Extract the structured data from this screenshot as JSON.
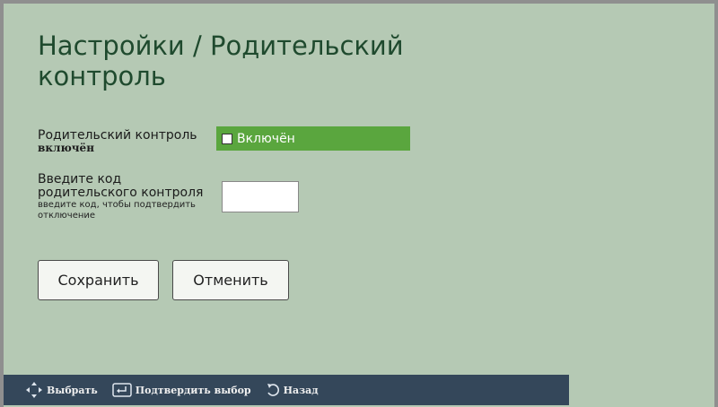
{
  "page": {
    "title": "Настройки / Родительский контроль"
  },
  "parental": {
    "status_label": "Родительский контроль",
    "status_value": "включён",
    "toggle_label": "Включён",
    "toggle_checked": false
  },
  "code": {
    "label": "Введите код родительского контроля",
    "hint": "введите код, чтобы подтвердить отключение",
    "value": ""
  },
  "buttons": {
    "save_label": "Сохранить",
    "cancel_label": "Отменить"
  },
  "footer": {
    "select_label": "Выбрать",
    "confirm_label": "Подтвердить выбор",
    "back_label": "Назад",
    "select_icon": "dpad-arrows-icon",
    "confirm_icon": "enter-key-icon",
    "back_icon": "back-arrow-icon"
  },
  "colors": {
    "background": "#b5c9b4",
    "title": "#1f4a2e",
    "toggle": "#5aa63e",
    "footer": "#34475a"
  }
}
